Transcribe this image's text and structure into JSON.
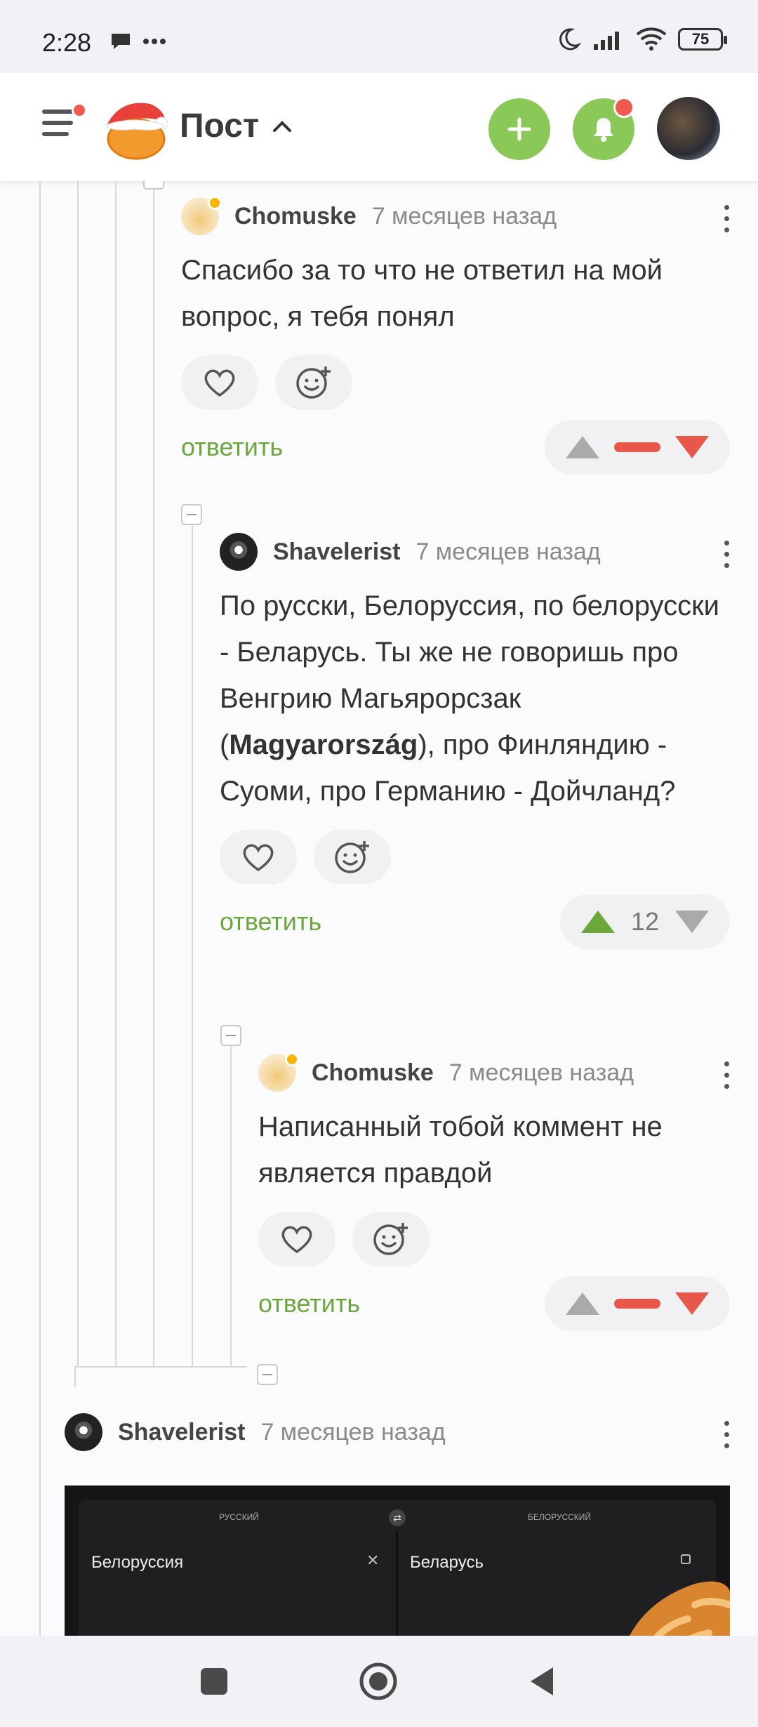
{
  "status": {
    "time": "2:28",
    "battery": "75",
    "icons": [
      "chat-bubble-icon",
      "more-dots-icon",
      "moon-icon",
      "signal-icon",
      "wifi-icon",
      "battery-icon"
    ]
  },
  "header": {
    "title": "Пост",
    "accent": "#8ac858",
    "icons": [
      "menu-icon",
      "logo",
      "chevron-up-icon",
      "plus-icon",
      "bell-icon",
      "user-avatar"
    ]
  },
  "comments": [
    {
      "author": "Chomuske",
      "time": "7 месяцев назад",
      "text": "Спасибо за то что не ответил на мой вопрос, я тебя понял",
      "reply_label": "ответить",
      "vote_state": "downvoted"
    },
    {
      "author": "Shavelerist",
      "time": "7 месяцев назад",
      "text_before": "По русски, Белоруссия, по белорусски - Беларусь. Ты же не говоришь про Венгрию Магьярорсзак (",
      "text_bold": "Magyarország",
      "text_after": "), про Финляндию - Суоми, про Германию - Дойчланд?",
      "reply_label": "ответить",
      "score": "12",
      "vote_state": "upvoted"
    },
    {
      "author": "Chomuske",
      "time": "7 месяцев назад",
      "text": "Написанный тобой коммент не является правдой",
      "reply_label": "ответить",
      "vote_state": "downvoted"
    },
    {
      "author": "Shavelerist",
      "time": "7 месяцев назад"
    }
  ],
  "translator_image": {
    "source_lang": "РУССКИЙ",
    "target_lang": "БЕЛОРУССКИЙ",
    "source_text": "Белоруссия",
    "target_text": "Беларусь"
  },
  "colors": {
    "reply_green": "#6aa83c",
    "downvote_red": "#e8584a",
    "notification_dot": "#f05a4f"
  }
}
